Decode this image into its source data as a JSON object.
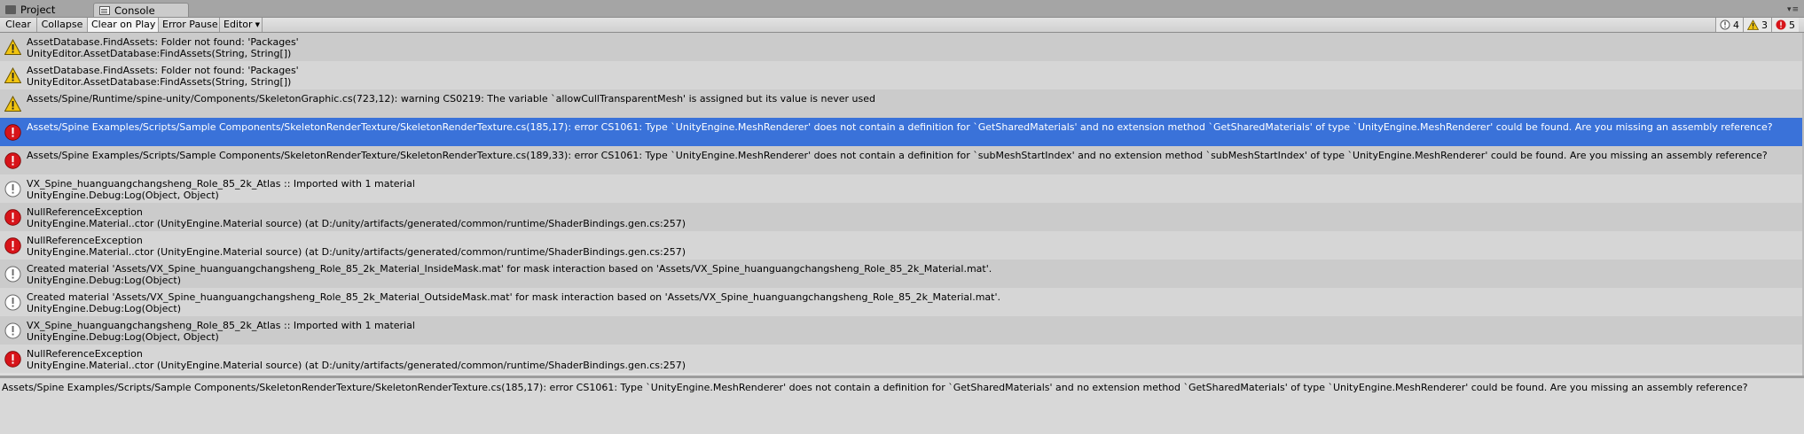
{
  "tabs": [
    {
      "label": "Project",
      "icon": "folder-icon"
    },
    {
      "label": "Console",
      "icon": "console-icon"
    }
  ],
  "toolbar": {
    "clear": "Clear",
    "collapse": "Collapse",
    "clear_on_play": "Clear on Play",
    "error_pause": "Error Pause",
    "editor": "Editor"
  },
  "counts": {
    "info": "4",
    "warning": "3",
    "error": "5"
  },
  "colors": {
    "selected": "#3a72d9",
    "error": "#d7141a",
    "warning": "#f1c40f"
  },
  "logs": [
    {
      "type": "warning",
      "line1": "AssetDatabase.FindAssets: Folder not found: 'Packages'",
      "line2": "UnityEditor.AssetDatabase:FindAssets(String, String[])"
    },
    {
      "type": "warning",
      "line1": "AssetDatabase.FindAssets: Folder not found: 'Packages'",
      "line2": "UnityEditor.AssetDatabase:FindAssets(String, String[])"
    },
    {
      "type": "warning",
      "line1": "Assets/Spine/Runtime/spine-unity/Components/SkeletonGraphic.cs(723,12): warning CS0219: The variable `allowCullTransparentMesh' is assigned but its value is never used",
      "line2": ""
    },
    {
      "type": "error",
      "selected": true,
      "line1": "Assets/Spine Examples/Scripts/Sample Components/SkeletonRenderTexture/SkeletonRenderTexture.cs(185,17): error CS1061: Type `UnityEngine.MeshRenderer' does not contain a definition for `GetSharedMaterials' and no extension method `GetSharedMaterials' of type `UnityEngine.MeshRenderer' could be found. Are you missing an assembly reference?",
      "line2": ""
    },
    {
      "type": "error",
      "line1": "Assets/Spine Examples/Scripts/Sample Components/SkeletonRenderTexture/SkeletonRenderTexture.cs(189,33): error CS1061: Type `UnityEngine.MeshRenderer' does not contain a definition for `subMeshStartIndex' and no extension method `subMeshStartIndex' of type `UnityEngine.MeshRenderer' could be found. Are you missing an assembly reference?",
      "line2": ""
    },
    {
      "type": "info",
      "line1": "VX_Spine_huanguangchangsheng_Role_85_2k_Atlas :: Imported with 1 material",
      "line2": "UnityEngine.Debug:Log(Object, Object)"
    },
    {
      "type": "error",
      "line1": "NullReferenceException",
      "line2": "UnityEngine.Material..ctor (UnityEngine.Material source) (at D:/unity/artifacts/generated/common/runtime/ShaderBindings.gen.cs:257)"
    },
    {
      "type": "error",
      "line1": "NullReferenceException",
      "line2": "UnityEngine.Material..ctor (UnityEngine.Material source) (at D:/unity/artifacts/generated/common/runtime/ShaderBindings.gen.cs:257)"
    },
    {
      "type": "info",
      "line1": "Created material 'Assets/VX_Spine_huanguangchangsheng_Role_85_2k_Material_InsideMask.mat' for mask interaction based on 'Assets/VX_Spine_huanguangchangsheng_Role_85_2k_Material.mat'.",
      "line2": "UnityEngine.Debug:Log(Object)"
    },
    {
      "type": "info",
      "line1": "Created material 'Assets/VX_Spine_huanguangchangsheng_Role_85_2k_Material_OutsideMask.mat' for mask interaction based on 'Assets/VX_Spine_huanguangchangsheng_Role_85_2k_Material.mat'.",
      "line2": "UnityEngine.Debug:Log(Object)"
    },
    {
      "type": "info",
      "line1": "VX_Spine_huanguangchangsheng_Role_85_2k_Atlas :: Imported with 1 material",
      "line2": "UnityEngine.Debug:Log(Object, Object)"
    },
    {
      "type": "error",
      "line1": "NullReferenceException",
      "line2": "UnityEngine.Material..ctor (UnityEngine.Material source) (at D:/unity/artifacts/generated/common/runtime/ShaderBindings.gen.cs:257)"
    }
  ],
  "detail": "Assets/Spine Examples/Scripts/Sample Components/SkeletonRenderTexture/SkeletonRenderTexture.cs(185,17): error CS1061: Type `UnityEngine.MeshRenderer' does not contain a definition for `GetSharedMaterials' and no extension method `GetSharedMaterials' of type `UnityEngine.MeshRenderer' could be found. Are you missing an assembly reference?"
}
